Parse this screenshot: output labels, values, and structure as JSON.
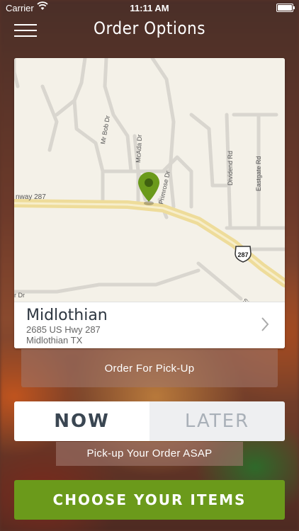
{
  "status_bar": {
    "carrier": "Carrier",
    "time": "11:11 AM"
  },
  "header": {
    "title": "Order Options"
  },
  "map": {
    "street_labels": {
      "hwy": "nway 287",
      "mr_bob": "Mr Bob Dr",
      "mcada": "McAda Dr",
      "primrose": "Primrose Dr",
      "dividend": "Dividend Rd",
      "eastgate": "Eastgate Rd",
      "r_dr": "r Dr",
      "shield": "287",
      "st": "St"
    },
    "pin_color": "#6b9a1b"
  },
  "location": {
    "name": "Midlothian",
    "address_line1": "2685 US Hwy 287",
    "address_line2": "Midlothian TX"
  },
  "order_type": {
    "label": "Order For Pick-Up"
  },
  "timing": {
    "now_label": "NOW",
    "later_label": "LATER",
    "selected": "NOW"
  },
  "asap_note": "Pick-up Your Order ASAP",
  "cta": {
    "label": "CHOOSE YOUR ITEMS",
    "color": "#6b9a1b"
  }
}
